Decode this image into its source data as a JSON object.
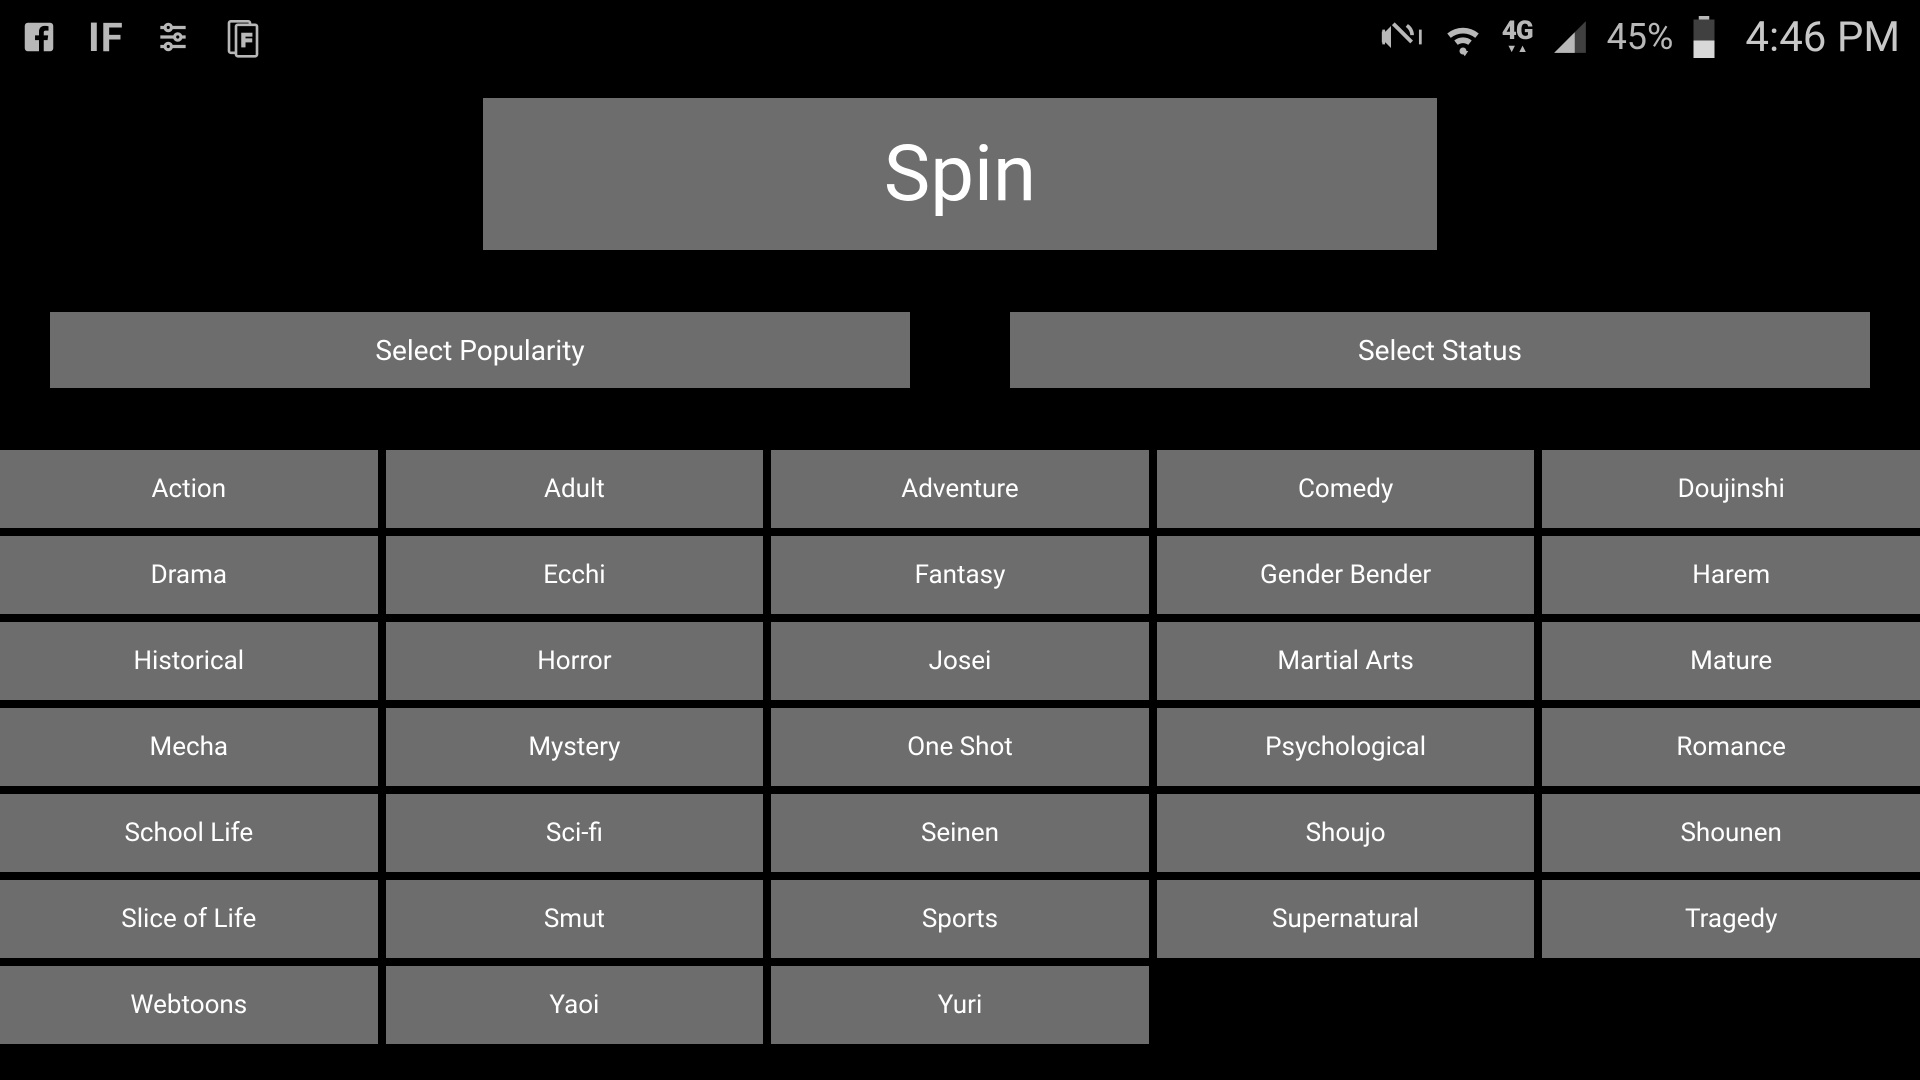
{
  "status_bar": {
    "battery_percent": "45%",
    "time": "4:46 PM",
    "network_label": "4G LTE"
  },
  "main": {
    "spin_label": "Spin",
    "popularity_label": "Select Popularity",
    "status_label": "Select Status"
  },
  "genres": [
    "Action",
    "Adult",
    "Adventure",
    "Comedy",
    "Doujinshi",
    "Drama",
    "Ecchi",
    "Fantasy",
    "Gender Bender",
    "Harem",
    "Historical",
    "Horror",
    "Josei",
    "Martial Arts",
    "Mature",
    "Mecha",
    "Mystery",
    "One Shot",
    "Psychological",
    "Romance",
    "School Life",
    "Sci-fi",
    "Seinen",
    "Shoujo",
    "Shounen",
    "Slice of Life",
    "Smut",
    "Sports",
    "Supernatural",
    "Tragedy",
    "Webtoons",
    "Yaoi",
    "Yuri"
  ]
}
